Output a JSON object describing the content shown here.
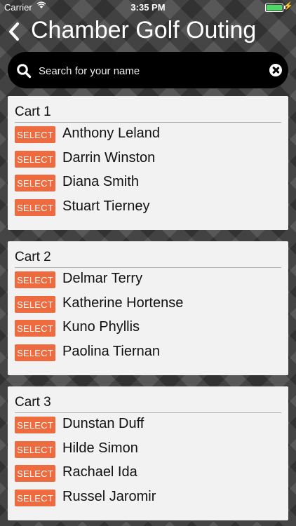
{
  "status_bar": {
    "carrier": "Carrier",
    "time": "3:35 PM"
  },
  "header": {
    "title": "Chamber Golf Outing",
    "back_icon": "chevron-left-icon"
  },
  "search": {
    "placeholder": "Search for your name",
    "value": ""
  },
  "select_label": "SELECT",
  "colors": {
    "select_button": "#ee6a3f",
    "card_background": "#f2f2f2",
    "search_bar": "#000000"
  },
  "carts": [
    {
      "name": "Cart 1",
      "golfers": [
        "Anthony Leland",
        "Darrin Winston",
        "Diana Smith",
        "Stuart Tierney"
      ]
    },
    {
      "name": "Cart 2",
      "golfers": [
        "Delmar Terry",
        "Katherine Hortense",
        "Kuno Phyllis",
        "Paolina Tiernan"
      ]
    },
    {
      "name": "Cart 3",
      "golfers": [
        "Dunstan Duff",
        "Hilde Simon",
        "Rachael Ida",
        "Russel Jaromir"
      ]
    }
  ]
}
